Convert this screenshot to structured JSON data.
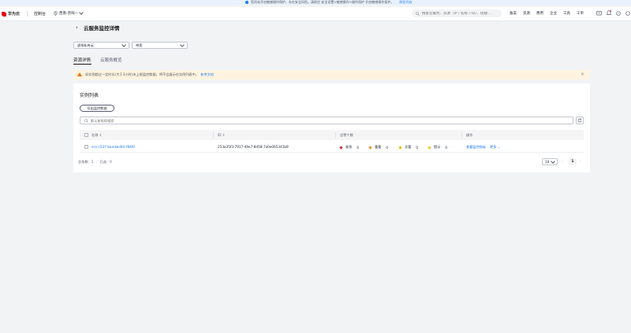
{
  "notice": {
    "text": "您尚未开启敏感操作保护，存在安全风险。请前往 安全设置>敏感操作>操作保护 开启敏感操作保护。",
    "link": "前往开启"
  },
  "topnav": {
    "brand": "华为云",
    "console": "控制台",
    "region": "西南-贵阳一",
    "search_placeholder": "搜索云服务、资源（IP / 名称 / ID）、快捷…",
    "links": [
      "备案",
      "资源",
      "费用",
      "企业",
      "工具",
      "工单"
    ]
  },
  "page": {
    "title": "云服务监控详情"
  },
  "filters": {
    "service": "虚拟私有云",
    "resource": "带宽"
  },
  "tabs": [
    {
      "label": "资源详情",
      "active": true
    },
    {
      "label": "云服务概览",
      "active": false
    }
  ],
  "warning": {
    "text": "如实例超过一定时长(大于3小时)未上报监控数据，将不会展示在实例列表中。",
    "link": "参考文档"
  },
  "instances": {
    "title": "实例列表",
    "export_label": "导出监控数据",
    "filter_placeholder": "默认按照ID搜索",
    "columns": {
      "name": "名称 ⇳",
      "id": "ID ⇳",
      "alarms": "告警个数",
      "actions": "操作"
    },
    "rows": [
      {
        "name": "ecs-c537-bandwidth-f84f0",
        "id": "253a35f3-7917-49e7-8d58-7a0e065341b9",
        "alarms": {
          "urgent": {
            "label": "紧急",
            "count": "0",
            "color": "#e5213b"
          },
          "major": {
            "label": "重要",
            "count": "0",
            "color": "#fa8c16"
          },
          "minor": {
            "label": "次要",
            "count": "0",
            "color": "#f0b400"
          },
          "hint": {
            "label": "提示",
            "count": "0",
            "color": "#f5c518"
          }
        },
        "action_view": "查看监控指标",
        "action_more": "更多 ⌄"
      }
    ],
    "footer": {
      "total": "总条数：1",
      "selected": "已选：0",
      "page_size": "10",
      "current_page": "1"
    }
  }
}
